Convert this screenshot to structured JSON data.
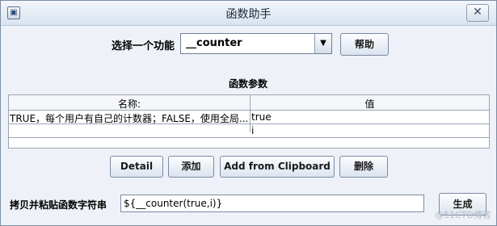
{
  "window": {
    "title": "函数助手",
    "close_glyph": "✕",
    "app_icon": "window-icon"
  },
  "function_select": {
    "label": "选择一个功能",
    "selected": "__counter",
    "arrow_glyph": "▼"
  },
  "buttons": {
    "help": "帮助",
    "detail": "Detail",
    "add": "添加",
    "add_clipboard": "Add from Clipboard",
    "delete": "删除",
    "generate": "生成"
  },
  "params": {
    "heading": "函数参数",
    "columns": [
      "名称:",
      "值"
    ],
    "rows": [
      {
        "name": "TRUE，每个用户有自己的计数器；FALSE，使用全局...",
        "value": "true"
      },
      {
        "name": "",
        "value": "i"
      }
    ]
  },
  "output": {
    "label": "拷贝并粘贴函数字符串",
    "value": "${__counter(true,i)}"
  },
  "watermark": "@51CTO博客"
}
